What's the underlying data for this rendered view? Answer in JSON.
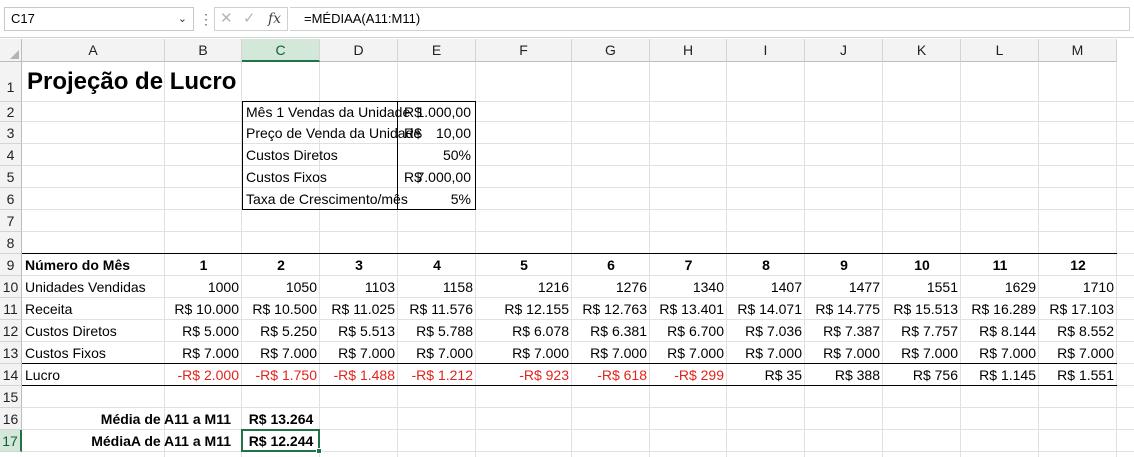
{
  "formula_bar": {
    "name_box": "C17",
    "formula": "=MÉDIAA(A11:M11)",
    "icons": [
      "chevron-down-icon",
      "more-icon",
      "cancel-icon",
      "enter-icon",
      "fx-icon"
    ]
  },
  "columns": [
    "A",
    "B",
    "C",
    "D",
    "E",
    "F",
    "G",
    "H",
    "I",
    "J",
    "K",
    "L",
    "M"
  ],
  "rows": [
    "1",
    "2",
    "3",
    "4",
    "5",
    "6",
    "7",
    "8",
    "9",
    "10",
    "11",
    "12",
    "13",
    "14",
    "15",
    "16",
    "17"
  ],
  "title": "Projeção de Lucro",
  "assumptions": [
    {
      "label": "Mês 1 Vendas da Unidade",
      "cur": "R$",
      "value": "1.000,00"
    },
    {
      "label": "Preço de Venda da Unidade",
      "cur": "R$",
      "value": "10,00"
    },
    {
      "label": "Custos Diretos",
      "cur": "",
      "value": "50%"
    },
    {
      "label": "Custos Fixos",
      "cur": "R$",
      "value": "7.000,00"
    },
    {
      "label": "Taxa de Crescimento/mês",
      "cur": "",
      "value": "5%"
    }
  ],
  "table": {
    "month_label": "Número do Mês",
    "months": [
      "1",
      "2",
      "3",
      "4",
      "5",
      "6",
      "7",
      "8",
      "9",
      "10",
      "11",
      "12"
    ],
    "rows": [
      {
        "label": "Unidades Vendidas",
        "values": [
          "1000",
          "1050",
          "1103",
          "1158",
          "1216",
          "1276",
          "1340",
          "1407",
          "1477",
          "1551",
          "1629",
          "1710"
        ]
      },
      {
        "label": "Receita",
        "values": [
          "R$ 10.000",
          "R$ 10.500",
          "R$ 11.025",
          "R$ 11.576",
          "R$ 12.155",
          "R$ 12.763",
          "R$ 13.401",
          "R$ 14.071",
          "R$ 14.775",
          "R$ 15.513",
          "R$ 16.289",
          "R$ 17.103"
        ]
      },
      {
        "label": "Custos Diretos",
        "values": [
          "R$ 5.000",
          "R$ 5.250",
          "R$ 5.513",
          "R$ 5.788",
          "R$ 6.078",
          "R$ 6.381",
          "R$ 6.700",
          "R$ 7.036",
          "R$ 7.387",
          "R$ 7.757",
          "R$ 8.144",
          "R$ 8.552"
        ]
      },
      {
        "label": "Custos Fixos",
        "values": [
          "R$ 7.000",
          "R$ 7.000",
          "R$ 7.000",
          "R$ 7.000",
          "R$ 7.000",
          "R$ 7.000",
          "R$ 7.000",
          "R$ 7.000",
          "R$ 7.000",
          "R$ 7.000",
          "R$ 7.000",
          "R$ 7.000"
        ]
      },
      {
        "label": "Lucro",
        "values": [
          "-R$ 2.000",
          "-R$ 1.750",
          "-R$ 1.488",
          "-R$ 1.212",
          "-R$ 923",
          "-R$ 618",
          "-R$ 299",
          "R$ 35",
          "R$ 388",
          "R$ 756",
          "R$ 1.145",
          "R$ 1.551"
        ]
      }
    ]
  },
  "summary": [
    {
      "label": "Média de A11 a M11",
      "value": "R$ 13.264"
    },
    {
      "label": "MédiaA de A11 a M11",
      "value": "R$ 12.244"
    }
  ],
  "colors": {
    "negative": "#e0241b",
    "selection": "#217346"
  }
}
